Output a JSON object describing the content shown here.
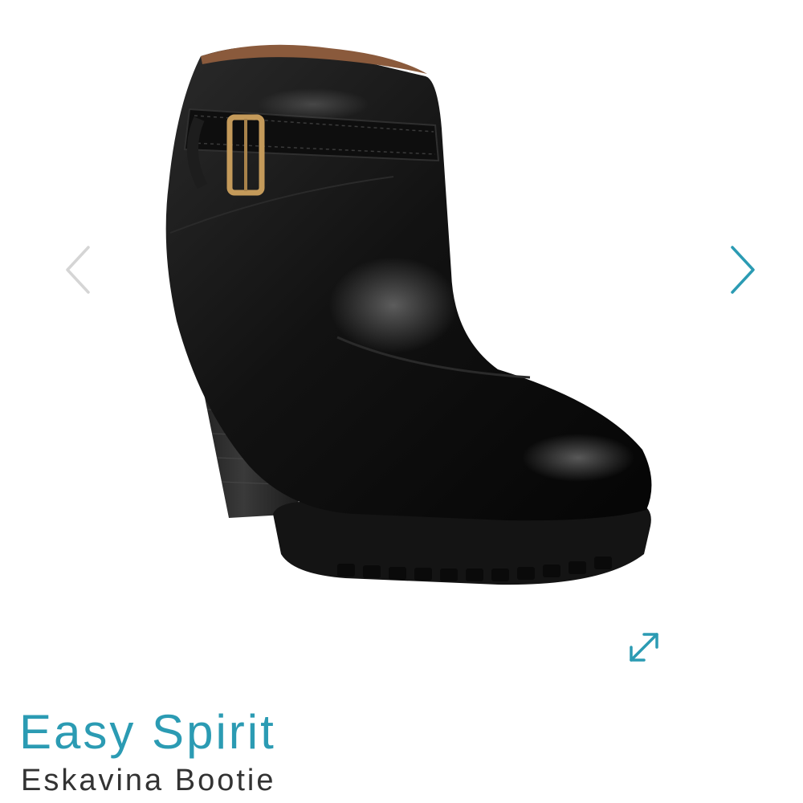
{
  "gallery": {
    "image": {
      "icon": "black-leather-ankle-bootie-photo"
    },
    "prev_icon": "chevron-left-icon",
    "next_icon": "chevron-right-icon",
    "expand_icon": "expand-arrows-icon"
  },
  "product": {
    "brand": "Easy Spirit",
    "name": "Eskavina Bootie"
  },
  "colors": {
    "accent": "#2b9bb3",
    "inactive_arrow": "#d5d5d5",
    "text": "#333333"
  }
}
